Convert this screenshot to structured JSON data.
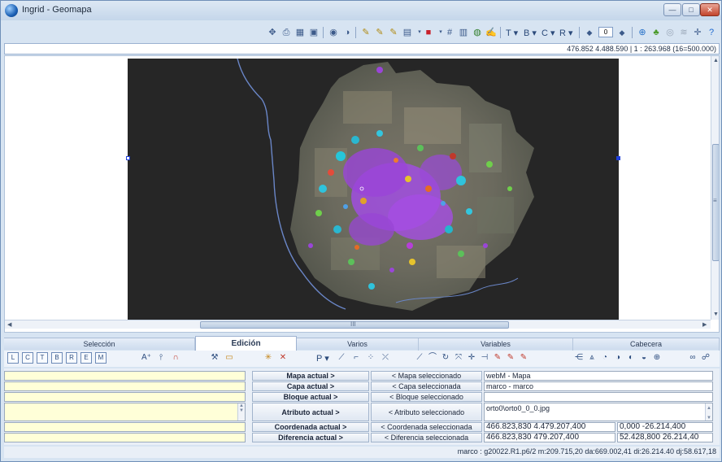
{
  "window": {
    "title": "Ingrid - Geomapa",
    "controls": {
      "minimize": "—",
      "maximize": "□",
      "close": "✕"
    }
  },
  "toolbar": {
    "icons": [
      "pan-icon",
      "print-icon",
      "layers-icon",
      "export-icon",
      "eye-icon",
      "contrast-icon",
      "pen-icon",
      "pencil-icon",
      "pencil2-icon",
      "page-icon",
      "color-icon",
      "grid-icon",
      "book-icon",
      "brush-icon"
    ],
    "t_label": "T",
    "b_label": "B",
    "c_label": "C",
    "r_label": "R",
    "scale_value": "0",
    "right_icons": [
      "web-icon",
      "tree-icon",
      "globe-icon",
      "layers-icon",
      "crosshair-icon",
      "help-icon"
    ]
  },
  "coords": {
    "text": "476.852  4.488.590  |  1 : 263.968 (16=500.000)"
  },
  "map": {
    "background_color": "#262626",
    "accent_selection": "#1f3fd8",
    "river_color": "#6a86c7"
  },
  "tabs": [
    {
      "label": "Selección",
      "active": false
    },
    {
      "label": "Edición",
      "active": true
    },
    {
      "label": "Varios",
      "active": false
    },
    {
      "label": "Variables",
      "active": false
    },
    {
      "label": "Cabecera",
      "active": false
    }
  ],
  "edit_toolbar": {
    "letter_buttons": [
      "L",
      "C",
      "T",
      "B",
      "R",
      "E",
      "M"
    ],
    "p_label": "P"
  },
  "panel": {
    "rows": [
      {
        "action": "Mapa actual >",
        "selected": "< Mapa seleccionado",
        "value": "webM - Mapa"
      },
      {
        "action": "Capa actual >",
        "selected": "< Capa seleccionada",
        "value": "marco - marco"
      },
      {
        "action": "Bloque actual >",
        "selected": "< Bloque seleccionado",
        "value": ""
      },
      {
        "action": "Atributo actual >",
        "selected": "< Atributo seleccionado",
        "value": "orto0\\orto0_0_0.jpg"
      },
      {
        "action": "Coordenada actual >",
        "selected": "< Coordenada seleccionada",
        "value": "466.823,830  4.479.207,400",
        "extra": "0,000  -26.214,400"
      },
      {
        "action": "Diferencia actual >",
        "selected": "< Diferencia seleccionada",
        "value": "466.823,830  479.207,400",
        "extra": "52.428,800  26.214,40"
      }
    ]
  },
  "status": {
    "text": "marco : g20022.R1.p6/2  m:209.715,20  da:669.002,41  di:26.214.40  dj:58.617,18"
  }
}
